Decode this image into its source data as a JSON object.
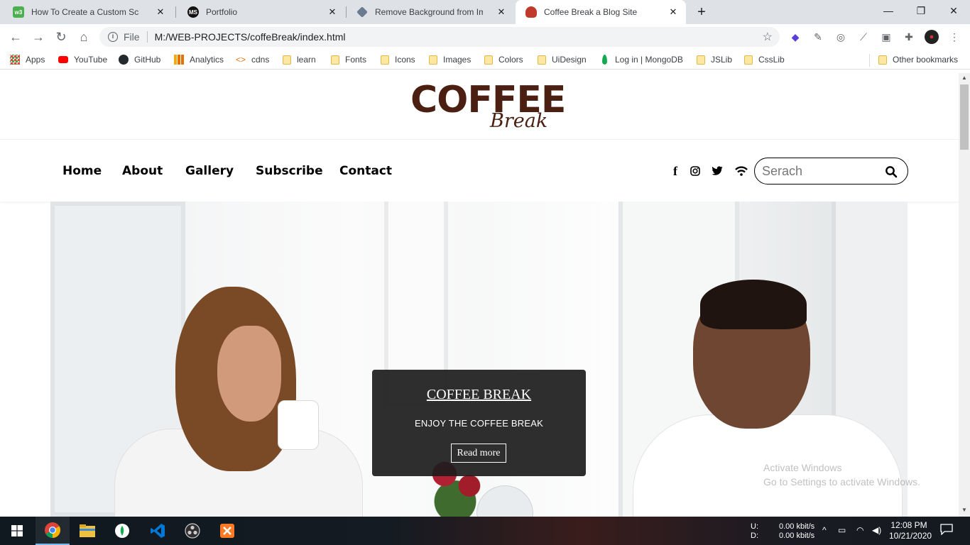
{
  "browser": {
    "tabs": [
      {
        "title": "How To Create a Custom Scrollba",
        "icon": "w3schools-icon"
      },
      {
        "title": "Portfolio",
        "icon": "ms-icon"
      },
      {
        "title": "Remove Background from Image",
        "icon": "removebg-icon"
      },
      {
        "title": "Coffee Break a Blog Site",
        "icon": "coffee-icon",
        "active": true
      }
    ],
    "address": {
      "scheme": "File",
      "url": "M:/WEB-PROJECTS/coffeBreak/index.html"
    },
    "bookmarks": [
      {
        "label": "Apps",
        "icon": "apps-grid-icon"
      },
      {
        "label": "YouTube",
        "icon": "youtube-icon"
      },
      {
        "label": "GitHub",
        "icon": "github-icon"
      },
      {
        "label": "Analytics",
        "icon": "analytics-icon"
      },
      {
        "label": "cdns",
        "icon": "code-icon"
      },
      {
        "label": "learn",
        "icon": "folder-icon"
      },
      {
        "label": "Fonts",
        "icon": "folder-icon"
      },
      {
        "label": "Icons",
        "icon": "folder-icon"
      },
      {
        "label": "Images",
        "icon": "folder-icon"
      },
      {
        "label": "Colors",
        "icon": "folder-icon"
      },
      {
        "label": "UiDesign",
        "icon": "folder-icon"
      },
      {
        "label": "Log in | MongoDB",
        "icon": "mongodb-icon"
      },
      {
        "label": "JSLib",
        "icon": "folder-icon"
      },
      {
        "label": "CssLib",
        "icon": "folder-icon"
      }
    ],
    "other_bookmarks": "Other bookmarks"
  },
  "site": {
    "logo": {
      "line1": "COFFEE",
      "line2": "Break"
    },
    "nav": [
      "Home",
      "About",
      "Gallery",
      "Subscribe",
      "Contact"
    ],
    "social": [
      "facebook-icon",
      "instagram-icon",
      "twitter-icon",
      "rss-icon"
    ],
    "search": {
      "placeholder": "Serach"
    },
    "hero": {
      "title": "COFFEE BREAK",
      "subtitle": "ENJOY THE COFFEE BREAK",
      "button": "Read more"
    },
    "watermark": {
      "line1": "Activate Windows",
      "line2": "Go to Settings to activate Windows."
    }
  },
  "taskbar": {
    "network": {
      "up_label": "U:",
      "down_label": "D:",
      "up": "0.00 kbit/s",
      "down": "0.00 kbit/s"
    },
    "time": "12:08 PM",
    "date": "10/21/2020"
  },
  "colors": {
    "brand": "#4b1f12",
    "caption_bg": "#1c1c1c",
    "tab_strip": "#dee1e6"
  }
}
